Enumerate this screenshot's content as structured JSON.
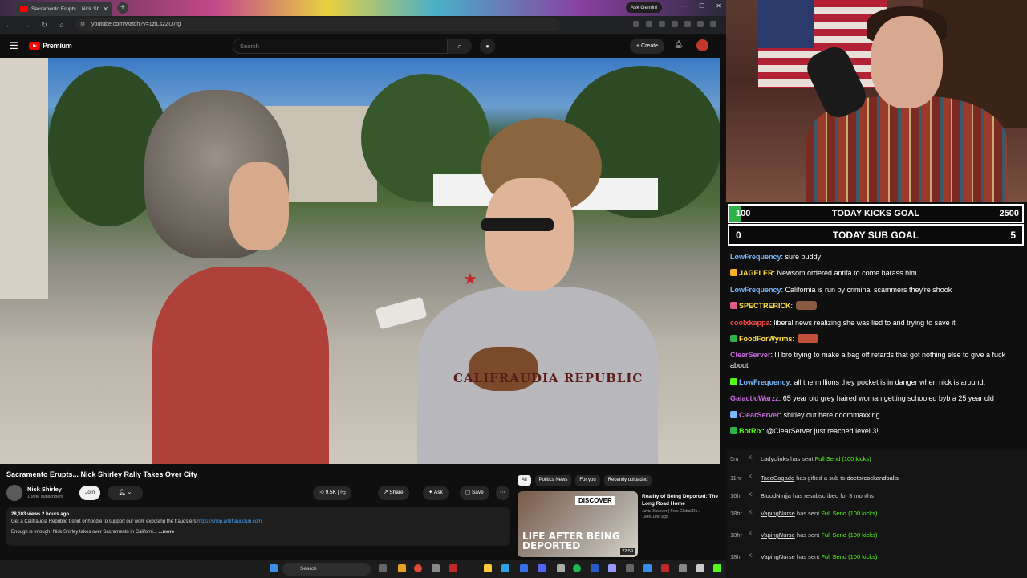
{
  "browser": {
    "tab_title": "Sacramento Erupts... Nick Sh",
    "ask_gemini": "Ask Gemini",
    "url": "youtube.com/watch?v=1zlLs2ZU7tg"
  },
  "youtube": {
    "logo_text": "Premium",
    "search_placeholder": "Search",
    "create_label": "Create",
    "video_title": "Sacramento Erupts... Nick Shirley Rally Takes Over City",
    "channel_name": "Nick Shirley",
    "channel_subs": "1.99M subscribers",
    "join_label": "Join",
    "likes": "9.5K",
    "share_label": "Share",
    "ask_label": "Ask",
    "save_label": "Save",
    "desc_meta": "28,103 views  2 hours ago",
    "desc_line1": "Get a Califraudia Republic t-shirt or hoodie to support our work exposing the fraudsters",
    "desc_link": "https://shop.antifraudclub.com",
    "desc_line2": "Enough is enough, Nick Shirley takes over Sacramento in Californi...",
    "desc_more": "...more",
    "video_overlay_text": "CALIFRAUDIA REPUBLIC",
    "chips": [
      "All",
      "Politics News",
      "For you",
      "Recently uploaded"
    ],
    "rec": {
      "title": "Reality of Being Deported: The Long Road Home",
      "channel": "Java Discover | Free Global Do...",
      "stats": "194K  1mo ago",
      "thumb_banner": "DISCOVER",
      "thumb_text": "LIFE AFTER BEING DEPORTED",
      "duration": "22:59"
    }
  },
  "taskbar": {
    "search_label": "Search"
  },
  "stream": {
    "kicks_goal": {
      "current": "100",
      "label": "TODAY KICKS GOAL",
      "target": "2500",
      "progress": 0.04
    },
    "sub_goal": {
      "current": "0",
      "label": "TODAY SUB GOAL",
      "target": "5"
    },
    "chat": [
      {
        "user": "LowFrequency",
        "color": "#7ab8ff",
        "text": ": sure buddy"
      },
      {
        "user": "JAGELER",
        "color": "#ffe14a",
        "text": ": Newsom ordered antifa to come harass him"
      },
      {
        "user": "LowFrequency",
        "color": "#7ab8ff",
        "text": ": California is run by criminal scammers they're shook"
      },
      {
        "user": "SPECTRERICK",
        "color": "#ffe14a",
        "text": ":"
      },
      {
        "user": "coolxkappa",
        "color": "#ff4a4a",
        "text": ": liberal news realizing she was lied to and trying to save it"
      },
      {
        "user": "FoodForWyrms",
        "color": "#ffe14a",
        "text": ":"
      },
      {
        "user": "ClearServer",
        "color": "#c86adf",
        "text": ": lil bro trying to make a bag off retards that got nothing else to give a fuck about"
      },
      {
        "user": "LowFrequency",
        "color": "#7ab8ff",
        "text": ": all the millions they pocket is in danger when nick is around."
      },
      {
        "user": "GalacticWarzz",
        "color": "#c86adf",
        "text": ": 65 year old grey haired woman getting schooled byb a 25 year old"
      },
      {
        "user": "ClearServer",
        "color": "#c86adf",
        "text": ": shirley out here doommaxxing"
      },
      {
        "user": "BotRix",
        "color": "#53fc18",
        "text": ": @ClearServer just reached level 3!"
      }
    ],
    "events": [
      {
        "time": "5m",
        "user": "Ladyclinks",
        "action": " has sent ",
        "item": "Full Send (100 kicks)"
      },
      {
        "time": "11hr",
        "user": "TacoCagado",
        "action": " has gifted a sub to ",
        "item": "doctorcockandballs."
      },
      {
        "time": "16hr",
        "user": "BloodNinjja",
        "action": " has resubscribed for 3 months",
        "item": ""
      },
      {
        "time": "18hr",
        "user": "VapingNurse",
        "action": " has sent ",
        "item": "Full Send (100 kicks)"
      },
      {
        "time": "18hr",
        "user": "VapingNurse",
        "action": " has sent ",
        "item": "Full Send (100 kicks)"
      },
      {
        "time": "18hr",
        "user": "VapingNurse",
        "action": " has sent ",
        "item": "Full Send (100 kicks)"
      }
    ]
  }
}
